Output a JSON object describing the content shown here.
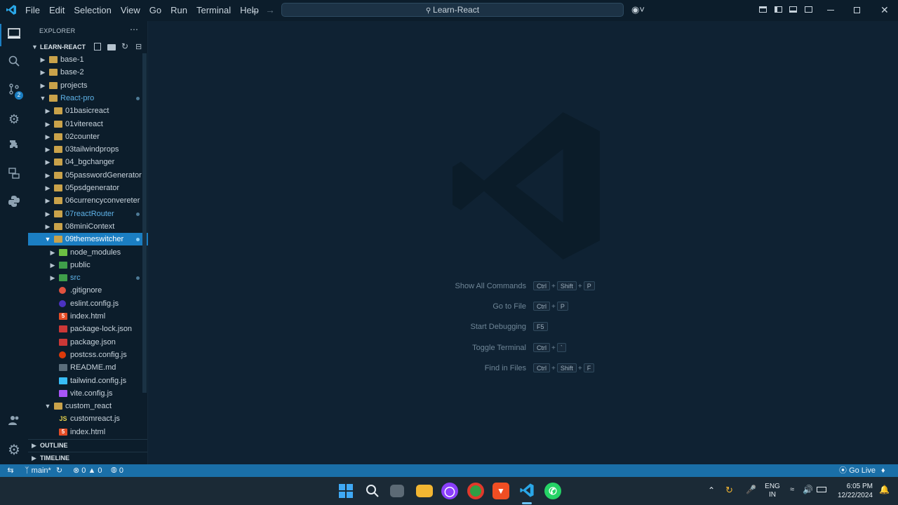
{
  "titlebar": {
    "menu": [
      "File",
      "Edit",
      "Selection",
      "View",
      "Go",
      "Run",
      "Terminal",
      "Help"
    ],
    "search_text": "Learn-React"
  },
  "sidebar": {
    "header": "EXPLORER",
    "project": "LEARN-REACT",
    "tree": [
      {
        "label": "base-1",
        "indent": 0,
        "type": "folder",
        "expanded": false,
        "modified": false
      },
      {
        "label": "base-2",
        "indent": 0,
        "type": "folder",
        "expanded": false,
        "modified": false
      },
      {
        "label": "projects",
        "indent": 0,
        "type": "folder",
        "expanded": false,
        "modified": false
      },
      {
        "label": "React-pro",
        "indent": 0,
        "type": "folder",
        "expanded": true,
        "modified": true
      },
      {
        "label": "01basicreact",
        "indent": 1,
        "type": "folder",
        "expanded": false,
        "modified": false
      },
      {
        "label": "01vitereact",
        "indent": 1,
        "type": "folder",
        "expanded": false,
        "modified": false
      },
      {
        "label": "02counter",
        "indent": 1,
        "type": "folder",
        "expanded": false,
        "modified": false
      },
      {
        "label": "03tailwindprops",
        "indent": 1,
        "type": "folder",
        "expanded": false,
        "modified": false
      },
      {
        "label": "04_bgchanger",
        "indent": 1,
        "type": "folder",
        "expanded": false,
        "modified": false
      },
      {
        "label": "05passwordGenerator",
        "indent": 1,
        "type": "folder",
        "expanded": false,
        "modified": false
      },
      {
        "label": "05psdgenerator",
        "indent": 1,
        "type": "folder",
        "expanded": false,
        "modified": false
      },
      {
        "label": "06currencyconvereter",
        "indent": 1,
        "type": "folder",
        "expanded": false,
        "modified": false
      },
      {
        "label": "07reactRouter",
        "indent": 1,
        "type": "folder",
        "expanded": false,
        "modified": true
      },
      {
        "label": "08miniContext",
        "indent": 1,
        "type": "folder",
        "expanded": false,
        "modified": false
      },
      {
        "label": "09themeswitcher",
        "indent": 1,
        "type": "folder",
        "expanded": true,
        "modified": true,
        "selected": true
      },
      {
        "label": "node_modules",
        "indent": 2,
        "type": "node",
        "expanded": false,
        "modified": false
      },
      {
        "label": "public",
        "indent": 2,
        "type": "public",
        "expanded": false,
        "modified": false
      },
      {
        "label": "src",
        "indent": 2,
        "type": "src",
        "expanded": false,
        "modified": true
      },
      {
        "label": ".gitignore",
        "indent": 2,
        "type": "git",
        "file": true
      },
      {
        "label": "eslint.config.js",
        "indent": 2,
        "type": "eslint",
        "file": true
      },
      {
        "label": "index.html",
        "indent": 2,
        "type": "html",
        "file": true
      },
      {
        "label": "package-lock.json",
        "indent": 2,
        "type": "npm",
        "file": true
      },
      {
        "label": "package.json",
        "indent": 2,
        "type": "npm",
        "file": true
      },
      {
        "label": "postcss.config.js",
        "indent": 2,
        "type": "postcss",
        "file": true
      },
      {
        "label": "README.md",
        "indent": 2,
        "type": "md",
        "file": true
      },
      {
        "label": "tailwind.config.js",
        "indent": 2,
        "type": "tailwind",
        "file": true
      },
      {
        "label": "vite.config.js",
        "indent": 2,
        "type": "vite",
        "file": true
      },
      {
        "label": "custom_react",
        "indent": 1,
        "type": "folder",
        "expanded": true,
        "modified": false
      },
      {
        "label": "customreact.js",
        "indent": 2,
        "type": "js",
        "file": true
      },
      {
        "label": "index.html",
        "indent": 2,
        "type": "html",
        "file": true
      }
    ],
    "outline": "OUTLINE",
    "timeline": "TIMELINE",
    "scm_badge": "2"
  },
  "editor": {
    "shortcuts": [
      {
        "label": "Show All Commands",
        "keys": [
          "Ctrl",
          "Shift",
          "P"
        ]
      },
      {
        "label": "Go to File",
        "keys": [
          "Ctrl",
          "P"
        ]
      },
      {
        "label": "Start Debugging",
        "keys": [
          "F5"
        ]
      },
      {
        "label": "Toggle Terminal",
        "keys": [
          "Ctrl",
          "`"
        ]
      },
      {
        "label": "Find in Files",
        "keys": [
          "Ctrl",
          "Shift",
          "F"
        ]
      }
    ]
  },
  "statusbar": {
    "branch": "main*",
    "errors": "0",
    "warnings": "0",
    "ports": "0",
    "golive": "Go Live"
  },
  "taskbar": {
    "lang_top": "ENG",
    "lang_bottom": "IN",
    "time": "6:05 PM",
    "date": "12/22/2024"
  },
  "colors": {
    "accent": "#1b7ec2",
    "statusbar": "#1a6fa8",
    "background": "#0f2233"
  }
}
